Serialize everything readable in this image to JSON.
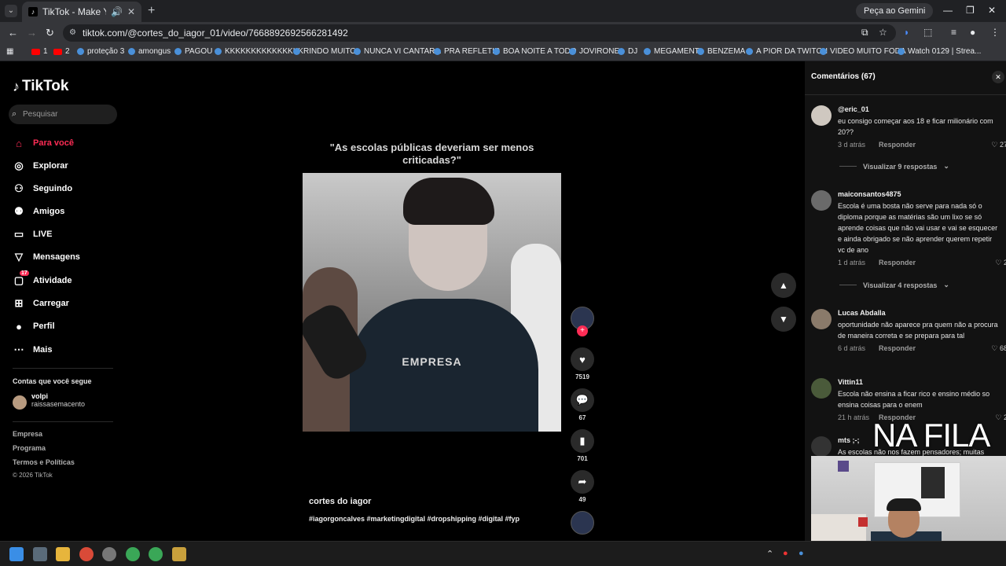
{
  "browser": {
    "tab_title": "TikTok - Make Your Day",
    "url": "tiktok.com/@cortes_do_iagor_01/video/7668892692566281492",
    "gemini_label": "Peça ao Gemini",
    "bookmarks": [
      {
        "label": "1",
        "icon": "youtube-icon"
      },
      {
        "label": "2",
        "icon": "youtube-icon"
      },
      {
        "label": "proteção 3",
        "icon": "globe-icon"
      },
      {
        "label": "amongus",
        "icon": "globe-icon"
      },
      {
        "label": "PAGOU",
        "icon": "globe-icon"
      },
      {
        "label": "KKKKKKKKKKKKKKK",
        "icon": "globe-icon"
      },
      {
        "label": "RINDO MUITO",
        "icon": "globe-icon"
      },
      {
        "label": "NUNCA VI CANTAR...",
        "icon": "globe-icon"
      },
      {
        "label": "PRA REFLETIR",
        "icon": "globe-icon"
      },
      {
        "label": "BOA NOITE A TODO",
        "icon": "globe-icon"
      },
      {
        "label": "JOVIRONE",
        "icon": "globe-icon"
      },
      {
        "label": "DJ",
        "icon": "globe-icon"
      },
      {
        "label": "MEGAMENT",
        "icon": "globe-icon"
      },
      {
        "label": "BENZEMA",
        "icon": "globe-icon"
      },
      {
        "label": "A PIOR DA TWITCH",
        "icon": "globe-icon"
      },
      {
        "label": "VIDEO MUITO FODA",
        "icon": "globe-icon"
      },
      {
        "label": "Watch 0129 | Strea...",
        "icon": "globe-icon"
      }
    ]
  },
  "sidebar": {
    "logo": "TikTok",
    "search_placeholder": "Pesquisar",
    "nav": [
      {
        "label": "Para você",
        "icon": "home-icon"
      },
      {
        "label": "Explorar",
        "icon": "compass-icon"
      },
      {
        "label": "Seguindo",
        "icon": "user-follow-icon"
      },
      {
        "label": "Amigos",
        "icon": "friends-icon"
      },
      {
        "label": "LIVE",
        "icon": "live-icon"
      },
      {
        "label": "Mensagens",
        "icon": "send-icon"
      },
      {
        "label": "Atividade",
        "icon": "activity-icon"
      },
      {
        "label": "Carregar",
        "icon": "upload-icon"
      },
      {
        "label": "Perfil",
        "icon": "profile-icon"
      },
      {
        "label": "Mais",
        "icon": "more-icon"
      }
    ],
    "activity_badge": "17",
    "following_title": "Contas que você segue",
    "following_account": {
      "name": "volpi",
      "handle": "raissasemacento"
    },
    "footer": [
      "Empresa",
      "Programa",
      "Termos e Políticas"
    ],
    "copyright": "© 2026 TikTok"
  },
  "video": {
    "quote": "\"As escolas públicas deveriam ser menos criticadas?\"",
    "shirt_text": "EMPRESA",
    "author": "cortes do iagor",
    "hashtags": "#iagorgoncalves #marketingdigital #dropshipping #digital #fyp",
    "likes": "7519",
    "comments": "67",
    "saves": "701",
    "shares": "49"
  },
  "comments_panel": {
    "title": "Comentários",
    "count": "(67)",
    "reply_label": "Responder",
    "items": [
      {
        "user": "@eric_01",
        "text": "eu consigo começar aos 18 e ficar milionário com 20??",
        "time": "3 d atrás",
        "likes": "27",
        "replies": "Visualizar 9 respostas"
      },
      {
        "user": "maiconsantos4875",
        "text": "Escola é uma bosta não serve para nada só o diploma porque as matérias são um lixo se só aprende coisas que não vai usar e vai se esquecer e ainda obrigado se não aprender querem repetir vc de ano",
        "time": "1 d atrás",
        "likes": "2",
        "replies": "Visualizar 4 respostas"
      },
      {
        "user": "Lucas Abdalla",
        "text": "oportunidade não aparece pra quem não a procura de maneira correta e se prepara para tal",
        "time": "6 d atrás",
        "likes": "68"
      },
      {
        "user": "Vittin11",
        "text": "Escola não ensina a ficar rico e ensino médio so ensina coisas para o enem",
        "time": "21 h atrás",
        "likes": "2"
      },
      {
        "user": "mts ;-;",
        "text": "As escolas não nos fazem pensadores; muitas"
      }
    ]
  },
  "overlay_text": "NA FILA"
}
